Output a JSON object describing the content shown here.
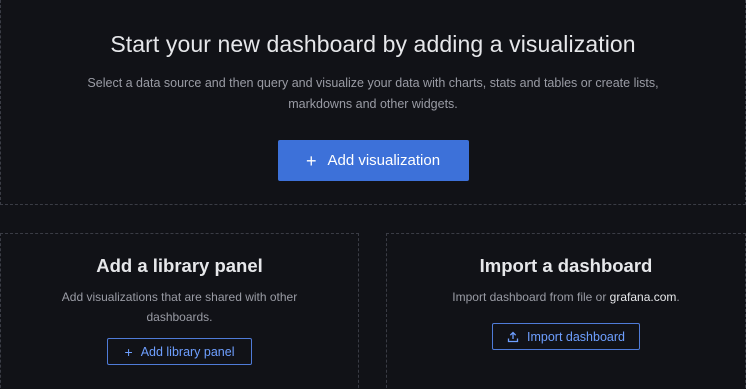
{
  "hero": {
    "title": "Start your new dashboard by adding a visualization",
    "description": "Select a data source and then query and visualize your data with charts, stats and tables or create lists, markdowns and other widgets.",
    "button_label": "Add visualization",
    "button_icon": "plus-icon"
  },
  "library_panel": {
    "title": "Add a library panel",
    "description": "Add visualizations that are shared with other dashboards.",
    "button_label": "Add library panel",
    "button_icon": "plus-icon"
  },
  "import_dashboard": {
    "title": "Import a dashboard",
    "description_prefix": "Import dashboard from file or ",
    "description_link": "grafana.com",
    "description_suffix": ".",
    "button_label": "Import dashboard",
    "button_icon": "upload-icon"
  },
  "colors": {
    "background": "#111217",
    "primary": "#3d71d9",
    "outline_text": "#6e9fff",
    "border": "#3a3c45"
  }
}
